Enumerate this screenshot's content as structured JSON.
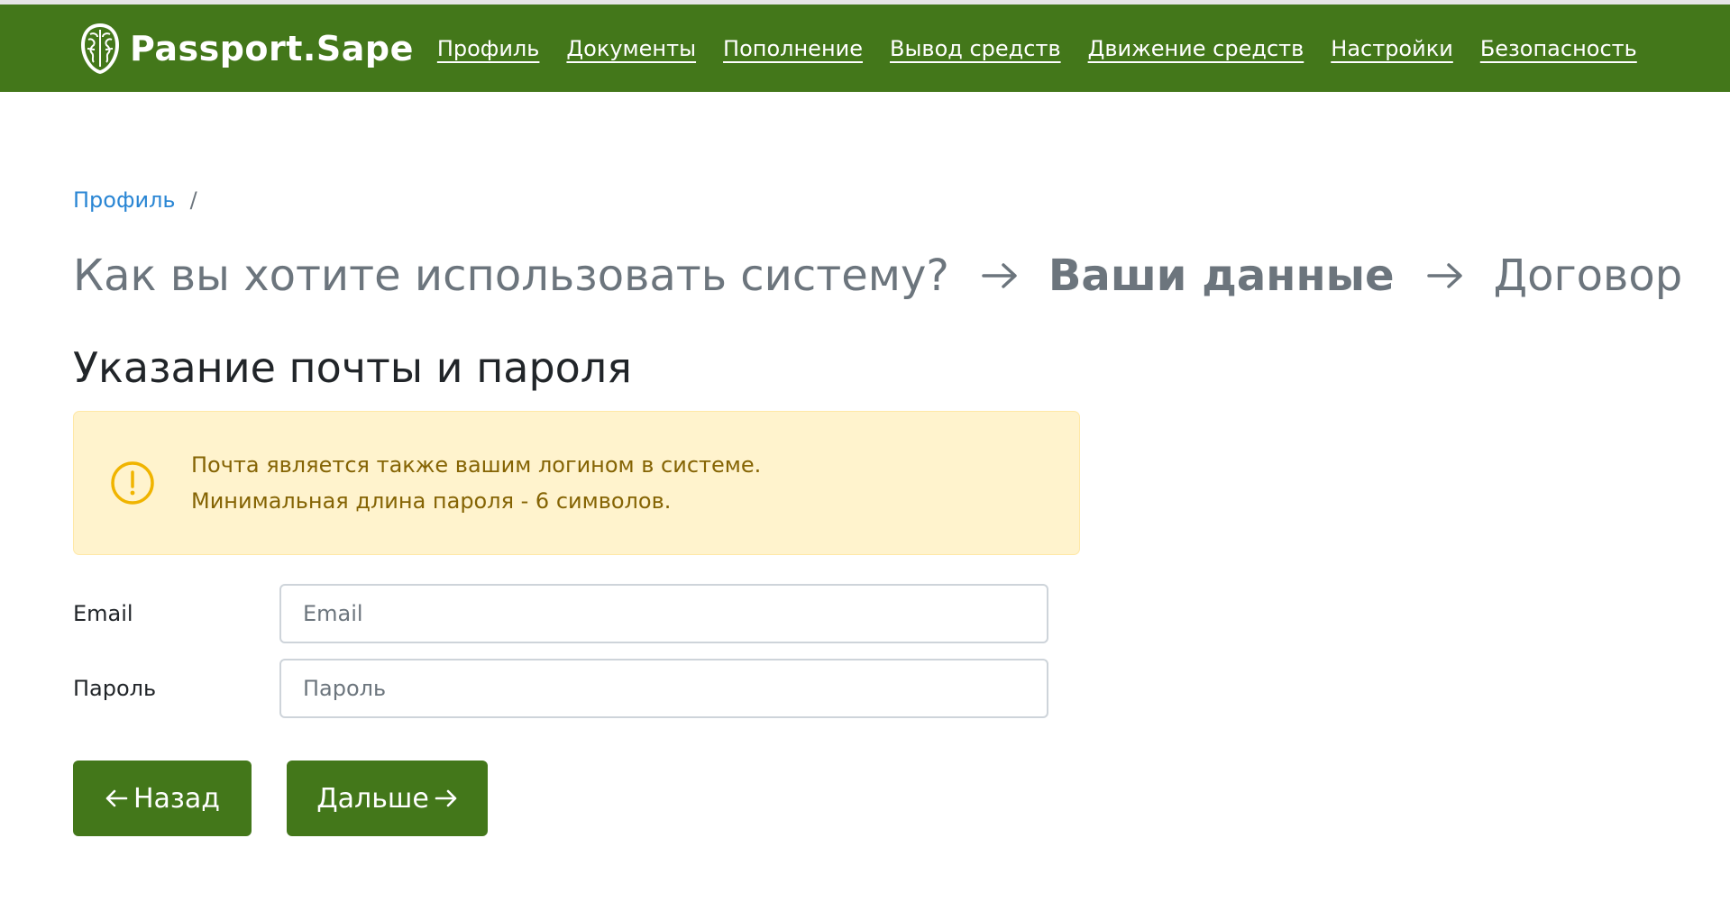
{
  "brand": {
    "name": "Passport.Sape",
    "logo_icon": "brain-icon"
  },
  "nav": {
    "items": [
      {
        "label": "Профиль"
      },
      {
        "label": "Документы"
      },
      {
        "label": "Пополнение"
      },
      {
        "label": "Вывод средств"
      },
      {
        "label": "Движение средств"
      },
      {
        "label": "Настройки"
      },
      {
        "label": "Безопасность"
      }
    ]
  },
  "breadcrumb": {
    "items": [
      {
        "label": "Профиль"
      }
    ],
    "separator": "/"
  },
  "steps": {
    "items": [
      {
        "label": "Как вы хотите использовать систему?",
        "active": false
      },
      {
        "label": "Ваши данные",
        "active": true
      },
      {
        "label": "Договор",
        "active": false
      }
    ],
    "arrow_icon": "arrow-right-icon"
  },
  "section": {
    "title": "Указание почты и пароля"
  },
  "alert": {
    "icon": "warning-circle-icon",
    "line1": "Почта является также вашим логином в системе.",
    "line2": "Минимальная длина пароля - 6 символов."
  },
  "form": {
    "email": {
      "label": "Email",
      "placeholder": "Email",
      "value": ""
    },
    "password": {
      "label": "Пароль",
      "placeholder": "Пароль",
      "value": ""
    }
  },
  "buttons": {
    "back_label": "Назад",
    "next_label": "Дальше"
  },
  "colors": {
    "brand_green": "#43771a",
    "link_blue": "#2a86d4",
    "alert_bg": "#fff3cd",
    "alert_text": "#856404",
    "alert_icon": "#f0b400",
    "muted_text": "#6c757d"
  }
}
